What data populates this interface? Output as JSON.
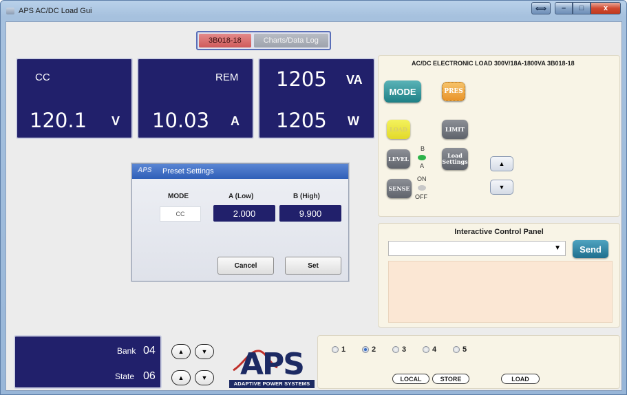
{
  "window": {
    "title": "APS AC/DC Load Gui",
    "controls": {
      "swap": "⟺",
      "minimize": "–",
      "maximize": "□",
      "close": "x"
    }
  },
  "tabs": [
    {
      "label": "3B018-18",
      "active": true
    },
    {
      "label": "Charts/Data Log",
      "active": false
    }
  ],
  "meters": {
    "mode": "CC",
    "voltage": {
      "value": "120.1",
      "unit": "V"
    },
    "remote": "REM",
    "current": {
      "value": "10.03",
      "unit": "A"
    },
    "apparent_power": {
      "value": "1205",
      "unit": "VA"
    },
    "power": {
      "value": "1205",
      "unit": "W"
    }
  },
  "control_panel": {
    "model_title": "AC/DC ELECTRONIC LOAD  300V/18A-1800VA  3B018-18",
    "buttons": {
      "mode": "MODE",
      "pres": "PRES",
      "load": "LOAD",
      "limit": "LIMIT",
      "level": "LEVEL",
      "load_settings_line1": "Load",
      "load_settings_line2": "Settings",
      "sense": "SENSE"
    },
    "level_indicator": {
      "top": "B",
      "bottom": "A"
    },
    "sense_indicator": {
      "top": "ON",
      "bottom": "OFF"
    },
    "arrow_up": "▲",
    "arrow_down": "▼"
  },
  "interactive_panel": {
    "title": "Interactive Control Panel",
    "command_value": "",
    "dropdown_caret": "▼",
    "send_label": "Send",
    "log_text": ""
  },
  "bank_state": {
    "bank_label": "Bank",
    "bank_value": "04",
    "state_label": "State",
    "state_value": "06",
    "up": "▲",
    "down": "▼"
  },
  "logo": {
    "text": "APS",
    "subtitle": "ADAPTIVE POWER SYSTEMS"
  },
  "presets": {
    "radios": [
      {
        "label": "1",
        "selected": false
      },
      {
        "label": "2",
        "selected": true
      },
      {
        "label": "3",
        "selected": false
      },
      {
        "label": "4",
        "selected": false
      },
      {
        "label": "5",
        "selected": false
      }
    ],
    "buttons": {
      "local": "LOCAL",
      "store": "STORE",
      "load": "LOAD"
    }
  },
  "dialog": {
    "title": "Preset Settings",
    "icon_text": "APS",
    "headers": {
      "mode": "MODE",
      "a": "A (Low)",
      "b": "B (High)"
    },
    "mode_value": "CC",
    "a_value": "2.000",
    "b_value": "9.900",
    "cancel": "Cancel",
    "set": "Set"
  },
  "colors": {
    "meter_bg": "#21206b",
    "panel_bg": "#f8f4e6",
    "mode_button": "#1e8086",
    "pres_button": "#e9942a",
    "load_button": "#e2d92a",
    "send_button": "#1f6f8e",
    "active_tab": "#cf5a5a",
    "dialog_title": "#2f5fb8"
  }
}
